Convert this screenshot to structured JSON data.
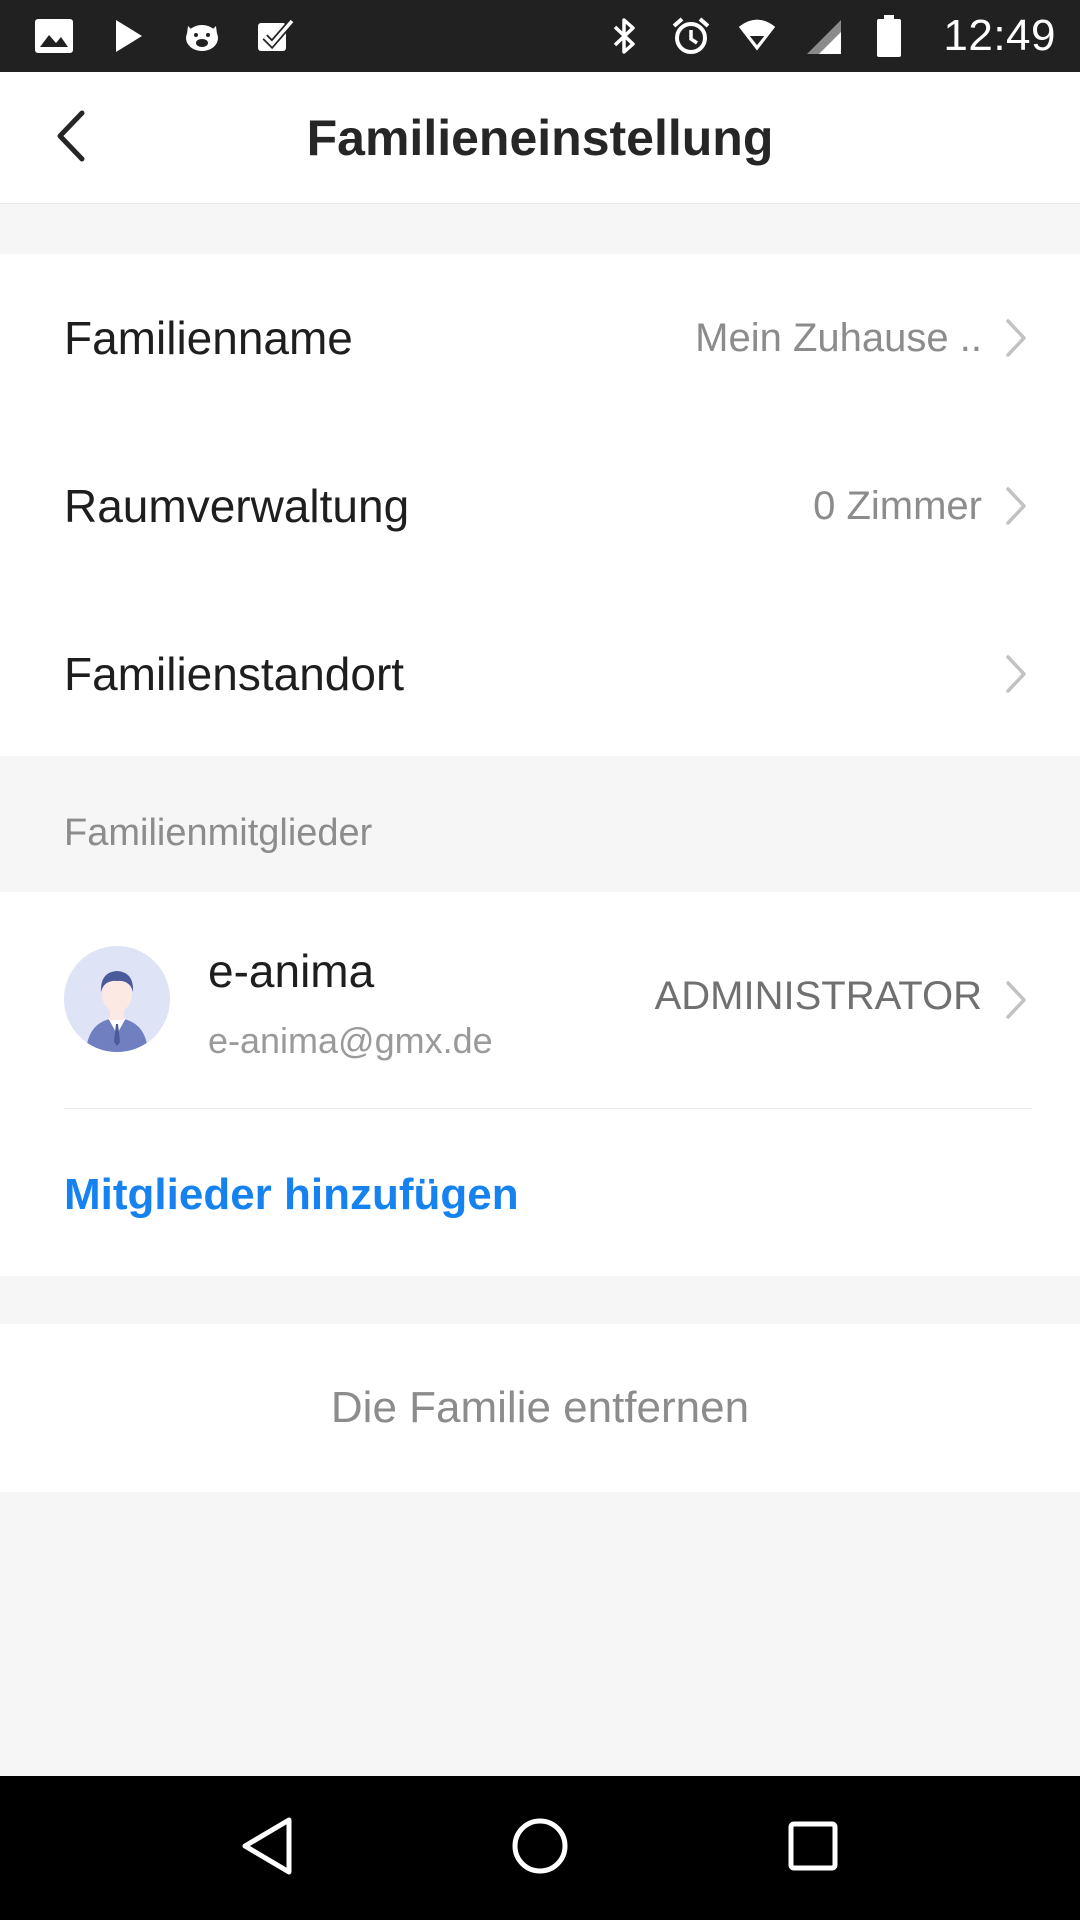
{
  "status_bar": {
    "time": "12:49",
    "left_icons": [
      "image-icon",
      "play-icon",
      "pig-icon",
      "checkbox-icon"
    ],
    "right_icons": [
      "bluetooth-icon",
      "alarm-icon",
      "wifi-icon",
      "cell-signal-icon",
      "battery-icon"
    ]
  },
  "header": {
    "title": "Familieneinstellung",
    "back_icon": "chevron-left-icon"
  },
  "settings": {
    "items": [
      {
        "label": "Familienname",
        "value": "Mein Zuhause .."
      },
      {
        "label": "Raumverwaltung",
        "value": "0 Zimmer"
      },
      {
        "label": "Familienstandort",
        "value": ""
      }
    ]
  },
  "members": {
    "section_label": "Familienmitglieder",
    "list": [
      {
        "name": "e-anima",
        "email": "e-anima@gmx.de",
        "role": "ADMINISTRATOR"
      }
    ],
    "add_label": "Mitglieder hinzufügen"
  },
  "remove": {
    "label": "Die Familie entfernen"
  },
  "nav_bar": {
    "icons": [
      "back-triangle-icon",
      "home-circle-icon",
      "recents-square-icon"
    ]
  },
  "colors": {
    "accent": "#1582f0",
    "background": "#f6f6f6",
    "card": "#ffffff",
    "status_bar": "#212121",
    "nav_bar": "#000000"
  }
}
